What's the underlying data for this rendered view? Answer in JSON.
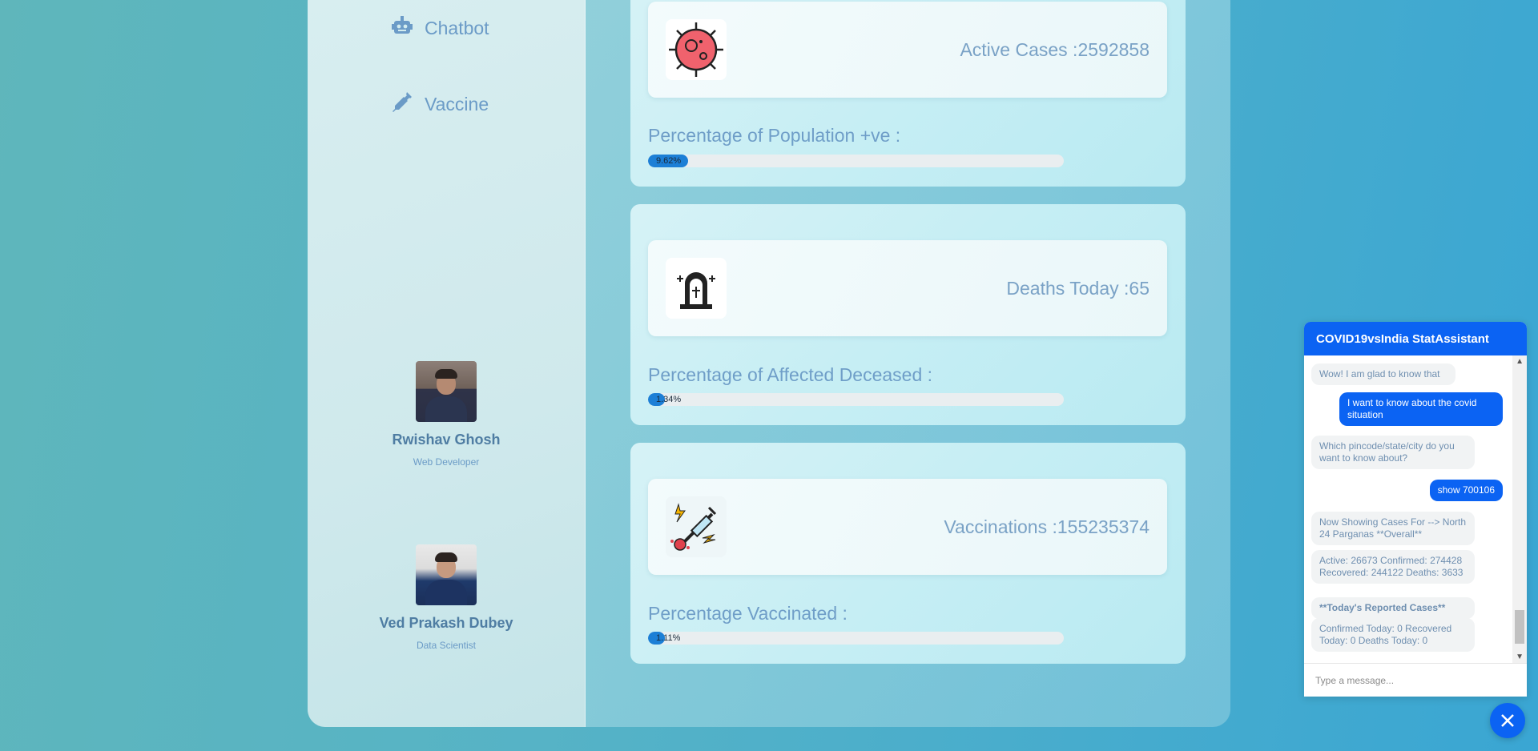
{
  "sidebar": {
    "nav": [
      {
        "label": "Chatbot",
        "icon": "robot-icon"
      },
      {
        "label": "Vaccine",
        "icon": "syringe-icon"
      }
    ],
    "profiles": [
      {
        "name": "Rwishav Ghosh",
        "role": "Web Developer"
      },
      {
        "name": "Ved Prakash Dubey",
        "role": "Data Scientist"
      }
    ]
  },
  "stats": [
    {
      "label": "Active Cases :",
      "value": "2592858",
      "icon": "virus-icon",
      "pct_label": "Percentage of Population +ve :",
      "pct_text": "9.62%",
      "pct": 9.62
    },
    {
      "label": "Deaths Today :",
      "value": "65",
      "icon": "tombstone-icon",
      "pct_label": "Percentage of Affected Deceased :",
      "pct_text": "1.34%",
      "pct": 1.34
    },
    {
      "label": "Vaccinations :",
      "value": "155235374",
      "icon": "vaccine-syringe-icon",
      "pct_label": "Percentage Vaccinated :",
      "pct_text": "1.11%",
      "pct": 1.11
    }
  ],
  "chat": {
    "title": "COVID19vsIndia StatAssistant",
    "messages": [
      {
        "from": "bot",
        "text": "Wow! I am glad to know that"
      },
      {
        "from": "user",
        "text": "I want to know about the covid situation"
      },
      {
        "from": "bot",
        "text": "Which pincode/state/city do you want to know about?"
      },
      {
        "from": "user",
        "text": "show 700106"
      },
      {
        "from": "bot",
        "text": "Now Showing Cases For --> North 24 Parganas **Overall**"
      },
      {
        "from": "bot",
        "text": "Active: 26673 Confirmed: 274428 Recovered: 244122 Deaths: 3633"
      },
      {
        "from": "bot",
        "text": "**Today's Reported Cases**"
      },
      {
        "from": "bot",
        "text": "Confirmed Today: 0 Recovered Today: 0 Deaths Today: 0"
      }
    ],
    "input_placeholder": "Type a message..."
  },
  "colors": {
    "accent": "#0b63f3",
    "bar": "#1c7fd6",
    "text": "#6b9bc7"
  }
}
